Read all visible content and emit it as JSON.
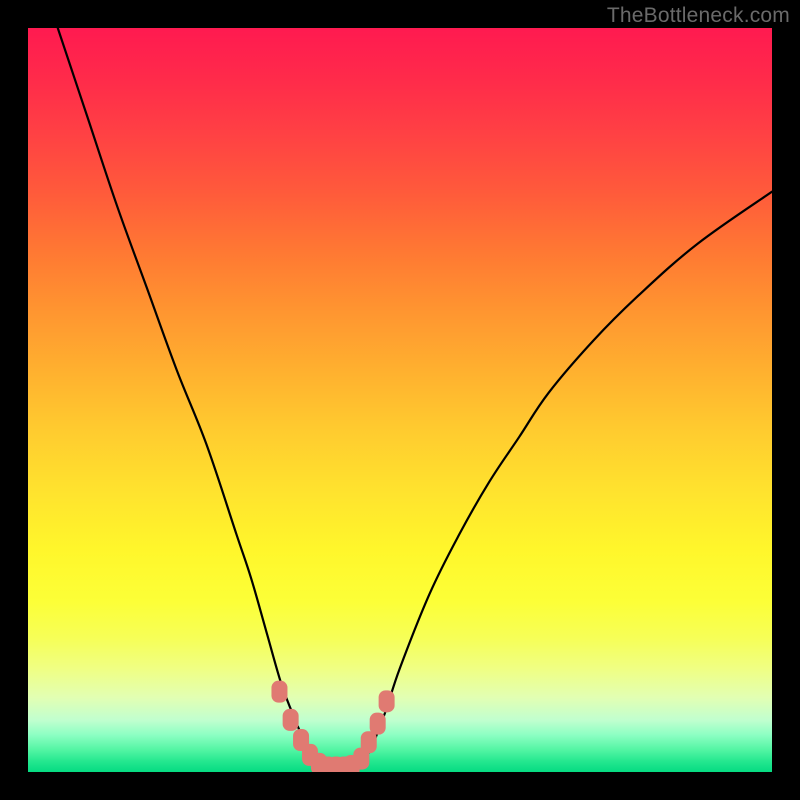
{
  "watermark": "TheBottleneck.com",
  "chart_data": {
    "type": "line",
    "title": "",
    "xlabel": "",
    "ylabel": "",
    "xlim": [
      0,
      100
    ],
    "ylim": [
      0,
      100
    ],
    "grid": false,
    "legend": false,
    "series": [
      {
        "name": "bottleneck-curve",
        "x": [
          4,
          8,
          12,
          16,
          20,
          24,
          28,
          30,
          32,
          34,
          35.5,
          37,
          38.5,
          40,
          41.5,
          43,
          44.5,
          46,
          48,
          50,
          54,
          58,
          62,
          66,
          70,
          76,
          82,
          90,
          100
        ],
        "values": [
          100,
          88,
          76,
          65,
          54,
          44,
          32,
          26,
          19,
          12,
          8,
          4.5,
          2,
          0.8,
          0.5,
          0.6,
          1.2,
          3,
          8,
          14,
          24,
          32,
          39,
          45,
          51,
          58,
          64,
          71,
          78
        ]
      },
      {
        "name": "highlighted-points",
        "x": [
          33.8,
          35.3,
          36.7,
          37.9,
          39.1,
          40.3,
          41.4,
          42.5,
          43.5,
          44.8,
          45.8,
          47.0,
          48.2
        ],
        "values": [
          10.8,
          7.0,
          4.3,
          2.3,
          1.1,
          0.6,
          0.6,
          0.6,
          0.8,
          1.8,
          4.0,
          6.5,
          9.5
        ]
      }
    ],
    "background_gradient": {
      "top_color": "#ff1a50",
      "mid_color": "#fff62b",
      "bottom_color": "#05db82"
    },
    "curve_color": "#000000",
    "point_color": "#e07a72"
  }
}
